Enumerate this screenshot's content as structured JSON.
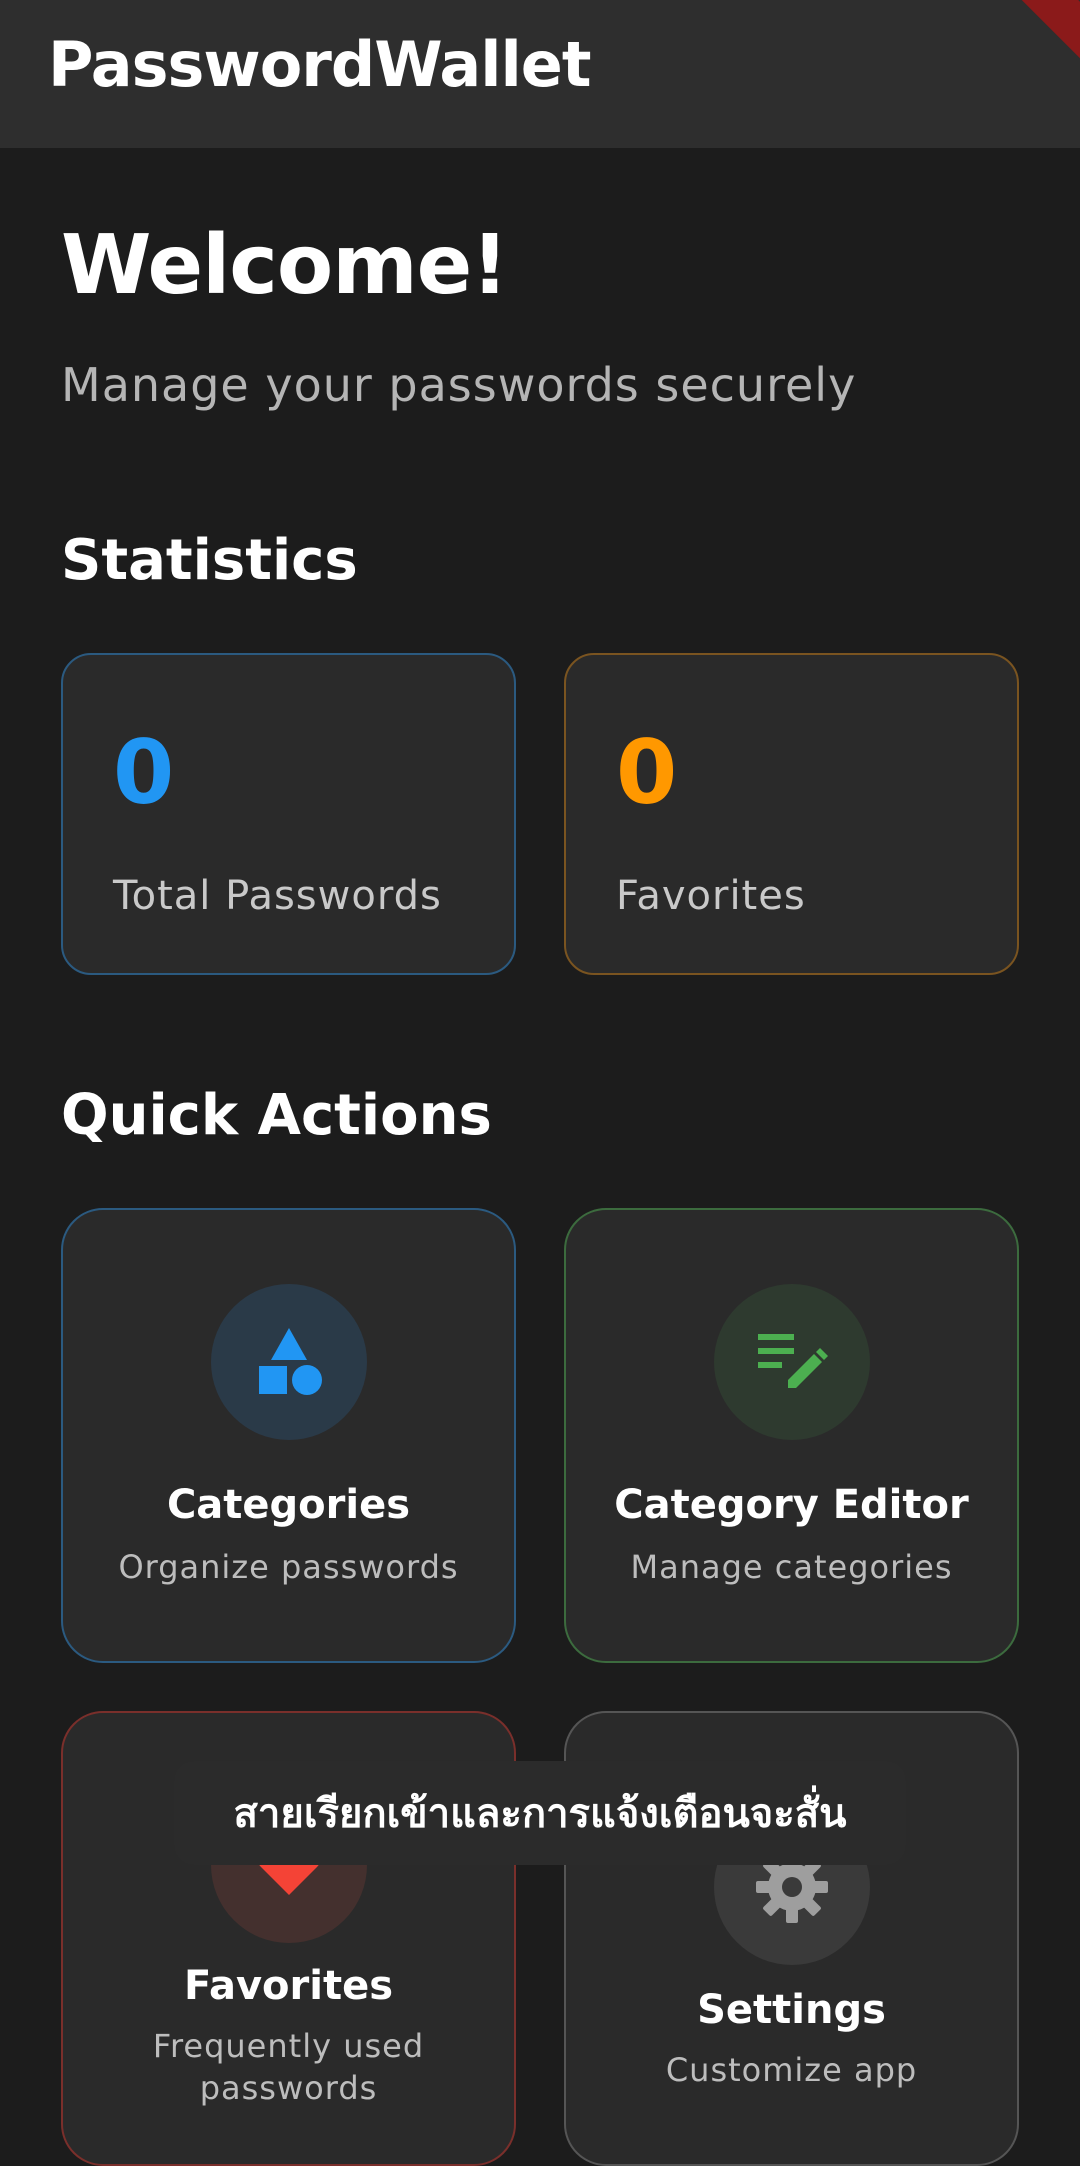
{
  "app": {
    "title": "PasswordWallet"
  },
  "welcome": {
    "title": "Welcome!",
    "subtitle": "Manage your passwords securely"
  },
  "statistics": {
    "heading": "Statistics",
    "cards": [
      {
        "value": "0",
        "label": "Total Passwords",
        "color": "#2196f3",
        "border": "#2b5a80"
      },
      {
        "value": "0",
        "label": "Favorites",
        "color": "#ff9800",
        "border": "#7a5420"
      }
    ]
  },
  "quick_actions": {
    "heading": "Quick Actions",
    "items": [
      {
        "title": "Categories",
        "subtitle": "Organize passwords",
        "icon": "category-icon",
        "color": "#2196f3",
        "border": "#2b5a80"
      },
      {
        "title": "Category Editor",
        "subtitle": "Manage categories",
        "icon": "edit-note-icon",
        "color": "#4caf50",
        "border": "#3c6b3e"
      },
      {
        "title": "Favorites",
        "subtitle": "Frequently used passwords",
        "icon": "favorite-icon",
        "color": "#f44336",
        "border": "#7a2f2b"
      },
      {
        "title": "Settings",
        "subtitle": "Customize app",
        "icon": "settings-icon",
        "color": "#9e9e9e",
        "border": "#555555"
      }
    ]
  },
  "toast": {
    "message": "สายเรียกเข้าและการแจ้งเตือนจะสั่น"
  }
}
